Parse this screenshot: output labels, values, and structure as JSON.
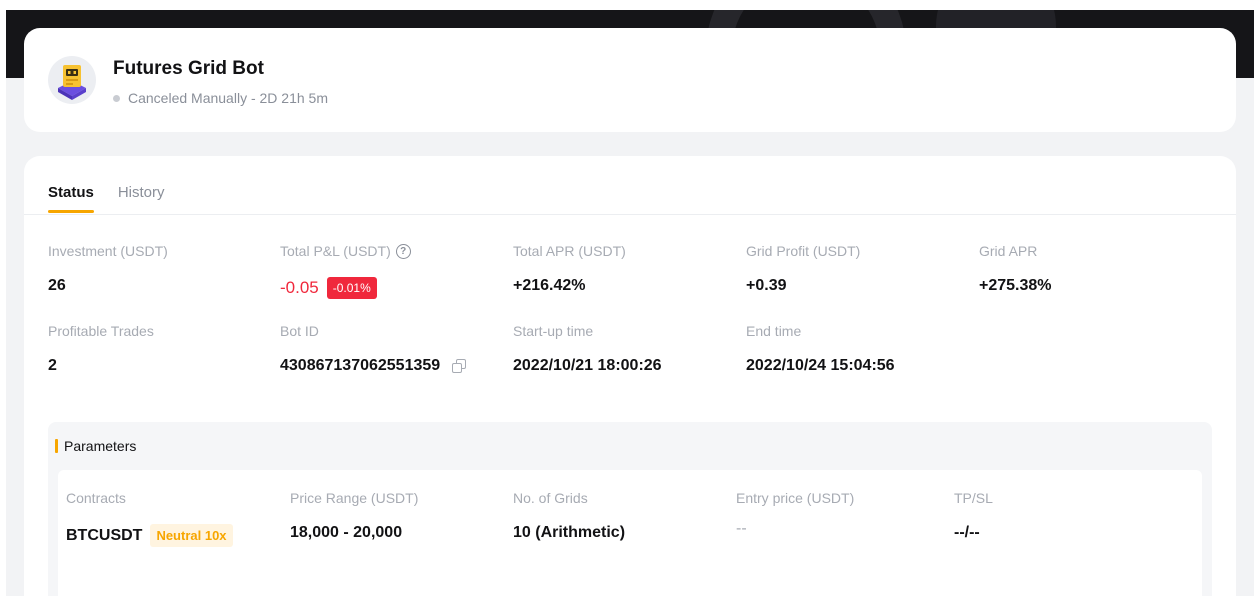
{
  "bot": {
    "title": "Futures Grid Bot",
    "status": "Canceled Manually - 2D 21h 5m"
  },
  "tabs": [
    {
      "label": "Status",
      "active": true
    },
    {
      "label": "History",
      "active": false
    }
  ],
  "stats": {
    "investment": {
      "label": "Investment (USDT)",
      "value": "26"
    },
    "total_pnl": {
      "label": "Total P&L (USDT)",
      "value": "-0.05",
      "badge": "-0.01%"
    },
    "total_apr": {
      "label": "Total APR (USDT)",
      "value": "+216.42%"
    },
    "grid_profit": {
      "label": "Grid Profit (USDT)",
      "value": "+0.39"
    },
    "grid_apr": {
      "label": "Grid APR",
      "value": "+275.38%"
    },
    "profitable_trades": {
      "label": "Profitable Trades",
      "value": "2"
    },
    "bot_id": {
      "label": "Bot ID",
      "value": "430867137062551359"
    },
    "startup_time": {
      "label": "Start-up time",
      "value": "2022/10/21 18:00:26"
    },
    "end_time": {
      "label": "End time",
      "value": "2022/10/24 15:04:56"
    }
  },
  "parameters": {
    "title": "Parameters",
    "contracts": {
      "label": "Contracts",
      "value": "BTCUSDT",
      "badge": "Neutral 10x"
    },
    "price_range": {
      "label": "Price Range (USDT)",
      "value": "18,000 - 20,000"
    },
    "grids": {
      "label": "No. of Grids",
      "value": "10 (Arithmetic)"
    },
    "entry_price": {
      "label": "Entry price (USDT)",
      "value": "--"
    },
    "tpsl": {
      "label": "TP/SL",
      "value": "--/--"
    }
  },
  "colors": {
    "accent": "#f7a600",
    "negative": "#f0283c",
    "muted": "#a7abb3"
  }
}
